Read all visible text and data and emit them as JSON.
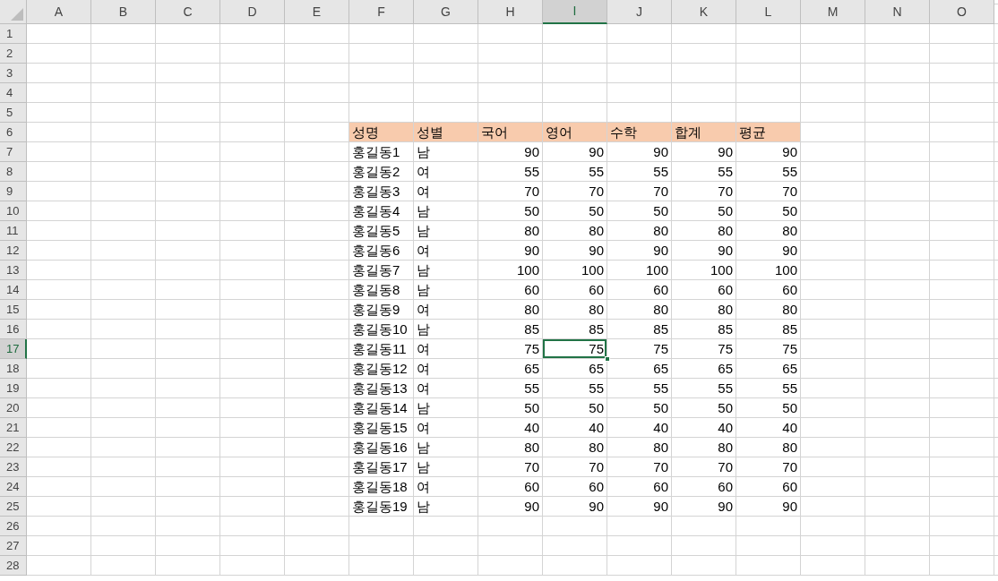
{
  "column_headers": [
    {
      "label": "A",
      "selected": false
    },
    {
      "label": "B",
      "selected": false
    },
    {
      "label": "C",
      "selected": false
    },
    {
      "label": "D",
      "selected": false
    },
    {
      "label": "E",
      "selected": false
    },
    {
      "label": "F",
      "selected": false
    },
    {
      "label": "G",
      "selected": false
    },
    {
      "label": "H",
      "selected": false
    },
    {
      "label": "I",
      "selected": true
    },
    {
      "label": "J",
      "selected": false
    },
    {
      "label": "K",
      "selected": false
    },
    {
      "label": "L",
      "selected": false
    },
    {
      "label": "M",
      "selected": false
    },
    {
      "label": "N",
      "selected": false
    },
    {
      "label": "O",
      "selected": false
    }
  ],
  "row_headers": [
    {
      "label": "1",
      "selected": false
    },
    {
      "label": "2",
      "selected": false
    },
    {
      "label": "3",
      "selected": false
    },
    {
      "label": "4",
      "selected": false
    },
    {
      "label": "5",
      "selected": false
    },
    {
      "label": "6",
      "selected": false
    },
    {
      "label": "7",
      "selected": false
    },
    {
      "label": "8",
      "selected": false
    },
    {
      "label": "9",
      "selected": false
    },
    {
      "label": "10",
      "selected": false
    },
    {
      "label": "11",
      "selected": false
    },
    {
      "label": "12",
      "selected": false
    },
    {
      "label": "13",
      "selected": false
    },
    {
      "label": "14",
      "selected": false
    },
    {
      "label": "15",
      "selected": false
    },
    {
      "label": "16",
      "selected": false
    },
    {
      "label": "17",
      "selected": true
    },
    {
      "label": "18",
      "selected": false
    },
    {
      "label": "19",
      "selected": false
    },
    {
      "label": "20",
      "selected": false
    },
    {
      "label": "21",
      "selected": false
    },
    {
      "label": "22",
      "selected": false
    },
    {
      "label": "23",
      "selected": false
    },
    {
      "label": "24",
      "selected": false
    },
    {
      "label": "25",
      "selected": false
    },
    {
      "label": "26",
      "selected": false
    },
    {
      "label": "27",
      "selected": false
    },
    {
      "label": "28",
      "selected": false
    }
  ],
  "data_table": {
    "columns": [
      "성명",
      "성별",
      "국어",
      "영어",
      "수학",
      "합계",
      "평균"
    ],
    "rows": [
      [
        "홍길동1",
        "남",
        "90",
        "90",
        "90",
        "90",
        "90"
      ],
      [
        "홍길동2",
        "여",
        "55",
        "55",
        "55",
        "55",
        "55"
      ],
      [
        "홍길동3",
        "여",
        "70",
        "70",
        "70",
        "70",
        "70"
      ],
      [
        "홍길동4",
        "남",
        "50",
        "50",
        "50",
        "50",
        "50"
      ],
      [
        "홍길동5",
        "남",
        "80",
        "80",
        "80",
        "80",
        "80"
      ],
      [
        "홍길동6",
        "여",
        "90",
        "90",
        "90",
        "90",
        "90"
      ],
      [
        "홍길동7",
        "남",
        "100",
        "100",
        "100",
        "100",
        "100"
      ],
      [
        "홍길동8",
        "남",
        "60",
        "60",
        "60",
        "60",
        "60"
      ],
      [
        "홍길동9",
        "여",
        "80",
        "80",
        "80",
        "80",
        "80"
      ],
      [
        "홍길동10",
        "남",
        "85",
        "85",
        "85",
        "85",
        "85"
      ],
      [
        "홍길동11",
        "여",
        "75",
        "75",
        "75",
        "75",
        "75"
      ],
      [
        "홍길동12",
        "여",
        "65",
        "65",
        "65",
        "65",
        "65"
      ],
      [
        "홍길동13",
        "여",
        "55",
        "55",
        "55",
        "55",
        "55"
      ],
      [
        "홍길동14",
        "남",
        "50",
        "50",
        "50",
        "50",
        "50"
      ],
      [
        "홍길동15",
        "여",
        "40",
        "40",
        "40",
        "40",
        "40"
      ],
      [
        "홍길동16",
        "남",
        "80",
        "80",
        "80",
        "80",
        "80"
      ],
      [
        "홍길동17",
        "남",
        "70",
        "70",
        "70",
        "70",
        "70"
      ],
      [
        "홍길동18",
        "여",
        "60",
        "60",
        "60",
        "60",
        "60"
      ],
      [
        "홍길동19",
        "남",
        "90",
        "90",
        "90",
        "90",
        "90"
      ]
    ]
  }
}
